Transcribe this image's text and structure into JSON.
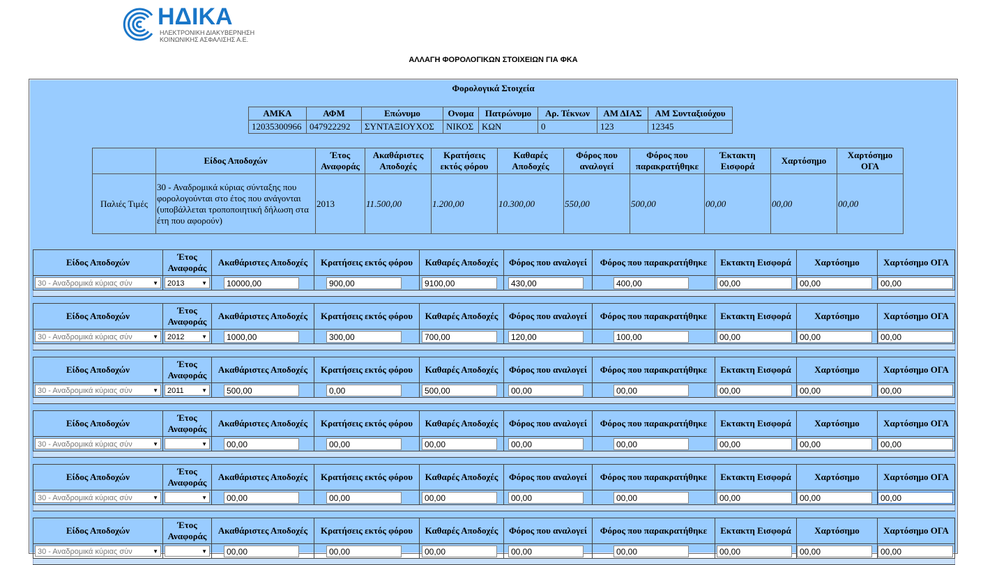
{
  "logo": {
    "word": "ΗΔΙΚΑ",
    "sub1": "ΗΛΕΚΤΡΟΝΙΚΗ ΔΙΑΚΥΒΕΡΝΗΣΗ",
    "sub2": "ΚΟΙΝΩΝΙΚΗΣ ΑΣΦΑΛΙΣΗΣ Α.Ε.",
    "color": "#1976c8"
  },
  "page_title": "ΑΛΛΑΓΗ ΦΟΡΟΛΟΓΙΚΩΝ ΣΤΟΙΧΕΙΩΝ ΓΙΑ ΦΚΑ",
  "section_title": "Φορολογικά Στοιχεία",
  "id_table": {
    "headers": [
      "ΑΜΚΑ",
      "ΑΦΜ",
      "Επώνυμο",
      "Ονομα",
      "Πατρώνυμο",
      "Αρ. Τέκνων",
      "ΑΜ ΔΙΑΣ",
      "ΑΜ Συνταξιούχου"
    ],
    "values": [
      "12035300966",
      "047922292",
      "ΣΥΝΤΑΞΙΟΥΧΟΣ",
      "ΝΙΚΟΣ",
      "ΚΩΝ",
      "0",
      "123",
      "12345"
    ]
  },
  "old_table": {
    "headers": [
      "",
      "Είδος Αποδοχών",
      "Έτος Αναφοράς",
      "Ακαθάριστες Αποδοχές",
      "Κρατήσεις εκτός φόρου",
      "Καθαρές Αποδοχές",
      "Φόρος που αναλογεί",
      "Φόρος που παρακρατήθηκε",
      "Έκτακτη Εισφορά",
      "Χαρτόσημο",
      "Χαρτόσημο ΟΓΑ"
    ],
    "row_label": "Παλιές Τιμές",
    "kind": "30 - Αναδρομικά κύριας σύνταξης που φορολογούνται στο έτος που ανάγονται (υποβάλλεται τροποποιητική δήλωση στα έτη που αφορούν)",
    "year": "2013",
    "values": [
      "11.500,00",
      "1.200,00",
      "10.300,00",
      "550,00",
      "500,00",
      "00,00",
      "00,00",
      "00,00"
    ]
  },
  "form_headers": [
    "Είδος Αποδοχών",
    "Έτος Αναφοράς",
    "Ακαθάριστες Αποδοχές",
    "Κρατήσεις εκτός φόρου",
    "Καθαρές Αποδοχές",
    "Φόρος που αναλογεί",
    "Φόρος που παρακρατήθηκε",
    "Εκτακτη Εισφορά",
    "Χαρτόσημο",
    "Χαρτόσημο ΟΓΑ"
  ],
  "rows": [
    {
      "kind": "30 - Αναδρομικά κύριας σύν",
      "year": "2013",
      "gross": "10000,00",
      "deductions": "900,00",
      "net": "9100,00",
      "tax_due": "430,00",
      "tax_withheld": "400,00",
      "extra": "00,00",
      "stamp": "00,00",
      "stamp_oga": "00,00"
    },
    {
      "kind": "30 - Αναδρομικά κύριας σύν",
      "year": "2012",
      "gross": "1000,00",
      "deductions": "300,00",
      "net": "700,00",
      "tax_due": "120,00",
      "tax_withheld": "100,00",
      "extra": "00,00",
      "stamp": "00,00",
      "stamp_oga": "00,00"
    },
    {
      "kind": "30 - Αναδρομικά κύριας σύν",
      "year": "2011",
      "gross": "500,00",
      "deductions": "0,00",
      "net": "500,00",
      "tax_due": "00,00",
      "tax_withheld": "00,00",
      "extra": "00,00",
      "stamp": "00,00",
      "stamp_oga": "00,00"
    },
    {
      "kind": "30 - Αναδρομικά κύριας σύν",
      "year": "",
      "gross": "00,00",
      "deductions": "00,00",
      "net": "00,00",
      "tax_due": "00,00",
      "tax_withheld": "00,00",
      "extra": "00,00",
      "stamp": "00,00",
      "stamp_oga": "00,00"
    },
    {
      "kind": "30 - Αναδρομικά κύριας σύν",
      "year": "",
      "gross": "00,00",
      "deductions": "00,00",
      "net": "00,00",
      "tax_due": "00,00",
      "tax_withheld": "00,00",
      "extra": "00,00",
      "stamp": "00,00",
      "stamp_oga": "00,00"
    },
    {
      "kind": "30 - Αναδρομικά κύριας σύν",
      "year": "",
      "gross": "00,00",
      "deductions": "00,00",
      "net": "00,00",
      "tax_due": "00,00",
      "tax_withheld": "00,00",
      "extra": "00,00",
      "stamp": "00,00",
      "stamp_oga": "00,00"
    }
  ],
  "colors": {
    "panel_bg": "#99ccff",
    "logo_blue": "#1976c8"
  }
}
